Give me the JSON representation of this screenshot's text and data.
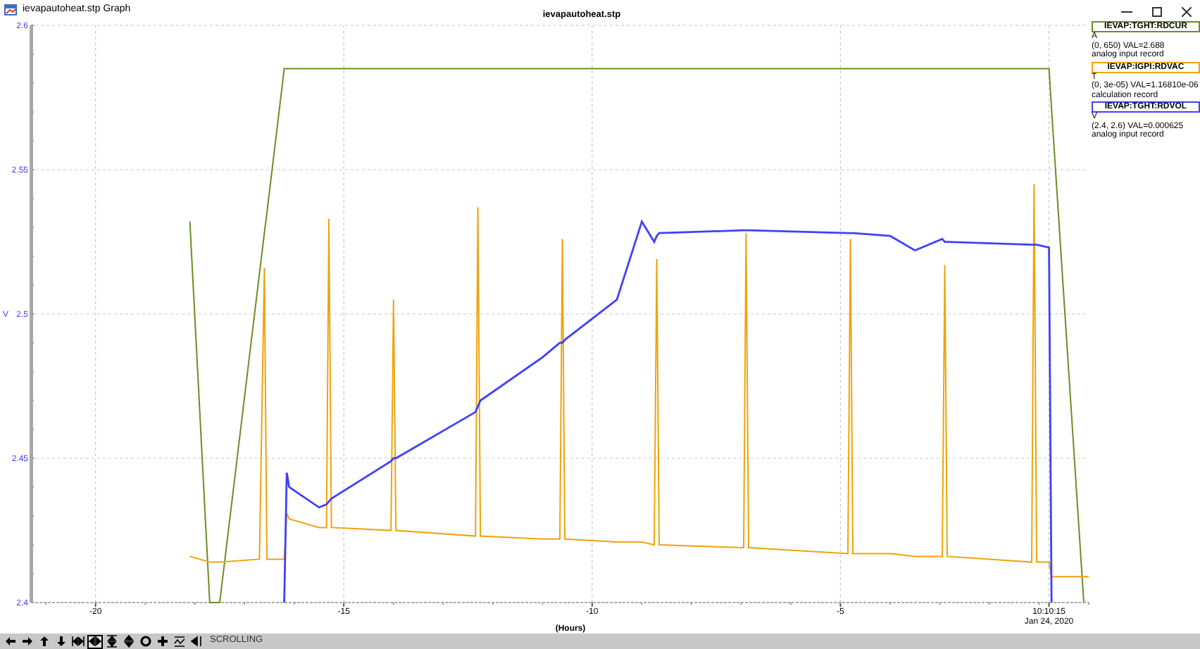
{
  "window": {
    "title": "ievapautoheat.stp Graph"
  },
  "graph": {
    "chart_data": {
      "type": "line",
      "title": "ievapautoheat.stp",
      "xlabel": "(Hours)",
      "ylabel": "V",
      "x": [
        -18.1,
        -17.7,
        -17.5,
        -16.7,
        -16.6,
        -16.55,
        -16.2,
        -16.15,
        -16.1,
        -15.5,
        -15.35,
        -15.3,
        -15.25,
        -14.05,
        -14,
        -13.95,
        -12.35,
        -12.3,
        -12.25,
        -11,
        -10.65,
        -10.6,
        -10.55,
        -9.5,
        -9,
        -8.75,
        -8.7,
        -8.65,
        -6.95,
        -6.9,
        -6.85,
        -4.85,
        -4.8,
        -4.75,
        -4,
        -3.5,
        -2.95,
        -2.9,
        -2.85,
        -1.15,
        -1.1,
        -1.05,
        -0.8,
        -0.75,
        -0.1,
        0
      ],
      "series": [
        {
          "name": "IEVAP:TGHT:RDCUR",
          "color": "#6b8e23",
          "values": [
            2.532,
            2.4,
            2.4,
            2.514,
            2.528,
            2.535,
            2.585,
            2.585,
            2.585,
            2.585,
            2.585,
            2.585,
            2.585,
            2.585,
            2.585,
            2.585,
            2.585,
            2.585,
            2.585,
            2.585,
            2.585,
            2.585,
            2.585,
            2.585,
            2.585,
            2.585,
            2.585,
            2.585,
            2.585,
            2.585,
            2.585,
            2.585,
            2.585,
            2.585,
            2.585,
            2.585,
            2.585,
            2.585,
            2.585,
            2.585,
            2.585,
            2.585,
            2.585,
            2.571,
            2.4,
            null
          ]
        },
        {
          "name": "IEVAP:IGPI:RDVAC",
          "color": "#f0a30a",
          "values": [
            2.416,
            2.414,
            2.414,
            2.415,
            2.516,
            2.415,
            2.415,
            2.431,
            2.429,
            2.426,
            2.426,
            2.533,
            2.426,
            2.425,
            2.505,
            2.425,
            2.423,
            2.537,
            2.423,
            2.422,
            2.422,
            2.526,
            2.422,
            2.421,
            2.421,
            2.42,
            2.519,
            2.42,
            2.419,
            2.528,
            2.419,
            2.417,
            2.526,
            2.417,
            2.417,
            2.416,
            2.416,
            2.517,
            2.416,
            2.414,
            2.545,
            2.414,
            2.414,
            2.409,
            2.409,
            2.409
          ]
        },
        {
          "name": "IEVAP:TGHT:RDVOL",
          "color": "#4040ff",
          "values": [
            null,
            null,
            null,
            null,
            null,
            null,
            2.4,
            2.445,
            2.44,
            2.433,
            2.434,
            2.435,
            2.436,
            2.449,
            2.45,
            2.45,
            2.466,
            2.468,
            2.47,
            2.485,
            2.49,
            2.49,
            2.491,
            2.505,
            2.532,
            2.525,
            2.527,
            2.528,
            2.529,
            2.529,
            2.529,
            2.528,
            2.528,
            2.528,
            2.527,
            2.522,
            2.526,
            2.525,
            2.525,
            2.524,
            2.524,
            2.524,
            2.523,
            2.4,
            null,
            null
          ]
        }
      ],
      "grid": true,
      "xlim": [
        -21.3,
        0
      ],
      "ylim": [
        2.4,
        2.6
      ],
      "xticks": [
        -20,
        -15,
        -10,
        -5,
        {
          "value": -0.8,
          "label": "10:10:15\nJan 24, 2020"
        }
      ],
      "yticks": [
        2.4,
        2.45,
        2.5,
        2.55,
        2.6
      ]
    }
  },
  "legend": [
    {
      "unit": "A",
      "range": "(0, 650) VAL=2.688",
      "record": "analog input record"
    },
    {
      "unit": "T",
      "range": "(0, 3e-05) VAL=1.16810e-06",
      "record": "calculation record"
    },
    {
      "unit": "V",
      "range": "(2.4, 2.6) VAL=0.000625",
      "record": "analog input record"
    }
  ],
  "toolbar": {
    "buttons": [
      {
        "selected": false
      },
      {
        "selected": false
      },
      {
        "selected": false
      },
      {
        "selected": false
      },
      {
        "selected": false
      },
      {
        "selected": true
      },
      {
        "selected": false
      },
      {
        "selected": false
      },
      {
        "selected": false
      },
      {
        "selected": false
      },
      {
        "selected": false
      },
      {
        "selected": false
      }
    ],
    "mode": "SCROLLING"
  }
}
